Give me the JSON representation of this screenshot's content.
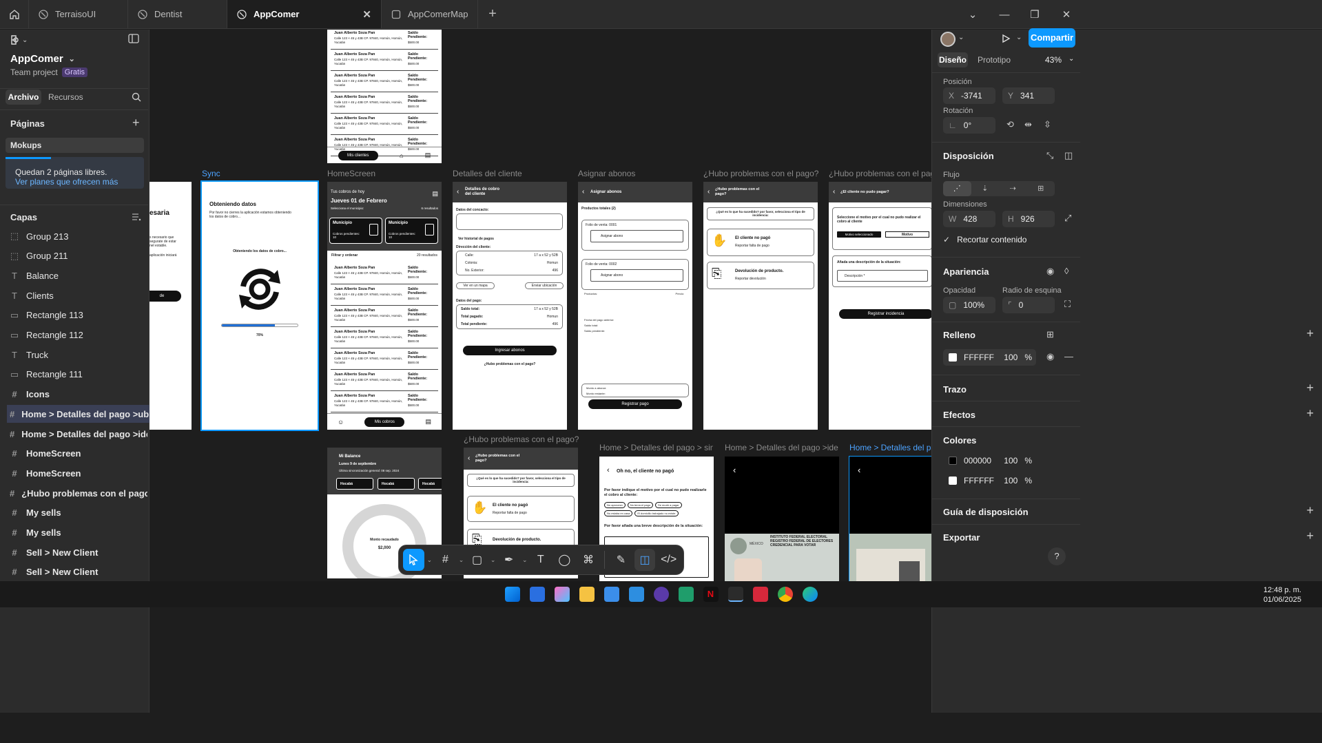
{
  "tabs": [
    {
      "label": "TerraisoUI"
    },
    {
      "label": "Dentist"
    },
    {
      "label": "AppComer",
      "close": "✕"
    },
    {
      "label": "AppComerMap"
    }
  ],
  "project": {
    "name": "AppComer",
    "team": "Team project",
    "plan_badge": "Gratis",
    "tabs": {
      "file": "Archivo",
      "assets": "Recursos"
    },
    "pages_title": "Páginas",
    "current_page": "Mokups",
    "upgrade_text": "Quedan 2 páginas libres.",
    "upgrade_link": "Ver planes que ofrecen más",
    "layers_title": "Capas"
  },
  "layers": [
    {
      "icon": "group",
      "label": "Group 213"
    },
    {
      "icon": "group",
      "label": "Group 211"
    },
    {
      "icon": "text",
      "label": "Balance"
    },
    {
      "icon": "text",
      "label": "Clients"
    },
    {
      "icon": "rect",
      "label": "Rectangle 113"
    },
    {
      "icon": "rect",
      "label": "Rectangle 112"
    },
    {
      "icon": "text",
      "label": "Truck"
    },
    {
      "icon": "rect",
      "label": "Rectangle 111"
    },
    {
      "icon": "frame",
      "label": "Icons"
    },
    {
      "icon": "frame",
      "label": "Home > Detalles del pago >ubicación"
    },
    {
      "icon": "frame",
      "label": "Home > Detalles del pago >identificac"
    },
    {
      "icon": "frame",
      "label": "HomeScreen"
    },
    {
      "icon": "frame",
      "label": "HomeScreen"
    },
    {
      "icon": "frame",
      "label": "¿Hubo problemas con el pago?"
    },
    {
      "icon": "frame",
      "label": "My sells"
    },
    {
      "icon": "frame",
      "label": "My sells"
    },
    {
      "icon": "frame",
      "label": "Sell > New Client"
    },
    {
      "icon": "frame",
      "label": "Sell > New Client"
    }
  ],
  "canvas": {
    "labels": {
      "sync": "Sync",
      "home": "HomeScreen",
      "details": "Detalles del cliente",
      "assign": "Asignar abonos",
      "problems1": "¿Hubo problemas con el pago?",
      "problems2": "¿Hubo problemas con el pago?",
      "problems3": "¿Hubo problemas con el pago?",
      "detalles_sin": "Home > Detalles del pago > sin ...",
      "detalles_ident": "Home > Detalles del pago >ident...",
      "detalles_sel": "Home > Detalles del pago"
    },
    "client_name": "Juan Alberto Soza Pan",
    "client_addr": "Calle 123 × 45 y 43B CP. 97840, Homún, Homún, Yucatán",
    "saldo_label": "Saldo Pendiente:",
    "saldo_value": "$500.00",
    "sync": {
      "title": "Obteniendo datos",
      "desc": "Por favor no cierres la aplicación estamos obteniendo los datos de cobro...",
      "loading": "Obteniendo los datos de cobro...",
      "progress_text": "70%",
      "progress": 0.7
    },
    "partial_screen": {
      "title": "esaria",
      "line1": "s necesario que",
      "line2": "segurate de estar",
      "line3": "nel estable.",
      "line4": "aplicación iniciará",
      "button": "de"
    },
    "home": {
      "header": "Tus cobros de hoy",
      "date": "Jueves 01 de Febrero",
      "select": "Selecciona el municipio:",
      "results": "6 resultados",
      "muni": "Municipio",
      "cobros": "Cobros pendientes: 10",
      "filter": "Filtrar y ordenar",
      "count": "20 resultados",
      "nav": "Mis cobros",
      "nav_top": "Mis clientes"
    },
    "details": {
      "title": "Detalles de cobro del cliente",
      "contact": "Datos del concacto:",
      "history": "Ver historial de pagos",
      "addr": "Dirección del cliente:",
      "calle": "Calle:",
      "calle_v": "17 a x 52 y 52B",
      "colonia": "Colonia:",
      "colonia_v": "Homun",
      "noext": "No. Exterior:",
      "noext_v": "496",
      "map_btn": "Ver en un mapa",
      "loc_btn": "Enviar ubicación",
      "pay": "Datos del pago:",
      "saldo_total": "Saldo total:",
      "total_pagado": "Total pagado:",
      "total_pend": "Total pendiente:",
      "btn": "Ingresar abonos",
      "link": "¿Hubo problemas con el pago?"
    },
    "assign": {
      "title": "Asignar abonos",
      "totals": "Productos totales (2)",
      "folio1": "Folio de venta: 0001",
      "folio2": "Folio de venta: 0002",
      "input": "Asignar abono",
      "productos": "Productos:",
      "precio": "Precio:",
      "fecha": "Fecha del pago anterior:",
      "saldo": "Saldo total:",
      "pend": "Saldo pendiente:",
      "monto": "Monto a abonar:",
      "restante": "Monto restante:",
      "btn": "Registrar pago"
    },
    "problems": {
      "title": "¿Hubo problemas con el pago?",
      "q": "¿Qué es lo que ha sucedido? por favor, selecciona el tipo de incidencia:",
      "opt1": "El cliente no pagó",
      "opt1_sub": "Reportar falta de pago",
      "opt2": "Devolución de producto.",
      "opt2_sub": "Reportar devolución"
    },
    "nopay": {
      "title": "¿El cliente no pudo pagar?",
      "q": "Seleccione el motivo por el cual no pudo realizar el cobro al cliente",
      "sel": "Motivo seleccionado",
      "motivo": "Motivo",
      "desc": "Añada una descripción de la situación:",
      "ph": "Descripción *",
      "btn": "Registrar incidencia"
    },
    "balance": {
      "title": "Mi Balance",
      "date": "Lunes 9 de septiembre",
      "sync": "Última sincronización general: 08 sep. 2024",
      "chip": "Hocabá",
      "monto": "Monto recaudado",
      "value": "$2,000"
    },
    "nopay2": {
      "title": "Oh no, el cliente no pagó",
      "q": "Por favor indique el motivo por el cual no pudo realizarle el cobro al cliente:",
      "tags": [
        "No aprovesó",
        "No tenía el pago",
        "Se mudó a pagar",
        "No estaba en casa",
        "El domicilio trabajado no existe"
      ],
      "desc": "Por favor añada una breve descripción de la situación:"
    },
    "ine": {
      "line1": "INSTITUTO FEDERAL ELECTORAL",
      "line2": "REGISTRO FEDERAL DE ELECTORES",
      "line3": "CREDENCIAL PARA VOTAR",
      "country": "MÉXICO"
    }
  },
  "right_panel": {
    "share": "Compartir",
    "tab_design": "Diseño",
    "tab_proto": "Prototipo",
    "zoom": "43%",
    "position": "Posición",
    "x_label": "X",
    "x": "-3741",
    "y_label": "Y",
    "y": "341",
    "rotation": "Rotación",
    "rot": "0°",
    "layout": "Disposición",
    "flow": "Flujo",
    "dimensions": "Dimensiones",
    "w_label": "W",
    "w": "428",
    "h_label": "H",
    "h": "926",
    "clip": "Recortar contenido",
    "appearance": "Apariencia",
    "opacity": "Opacidad",
    "opacity_v": "100%",
    "radius": "Radio de esquina",
    "radius_v": "0",
    "fill": "Relleno",
    "fill_hex": "FFFFFF",
    "fill_pct": "100",
    "pct": "%",
    "stroke": "Trazo",
    "effects": "Efectos",
    "colors": "Colores",
    "color1_hex": "000000",
    "color1_pct": "100",
    "color2_hex": "FFFFFF",
    "color2_pct": "100",
    "guide": "Guía de disposición",
    "export": "Exportar",
    "help": "?"
  },
  "taskbar": {
    "time": "12:48 p. m.",
    "date": "01/06/2025"
  },
  "colors": {
    "accent": "#0d99ff",
    "panel": "#2c2c2c",
    "canvas": "#1e1e1e",
    "selection": "#3a3f55"
  }
}
